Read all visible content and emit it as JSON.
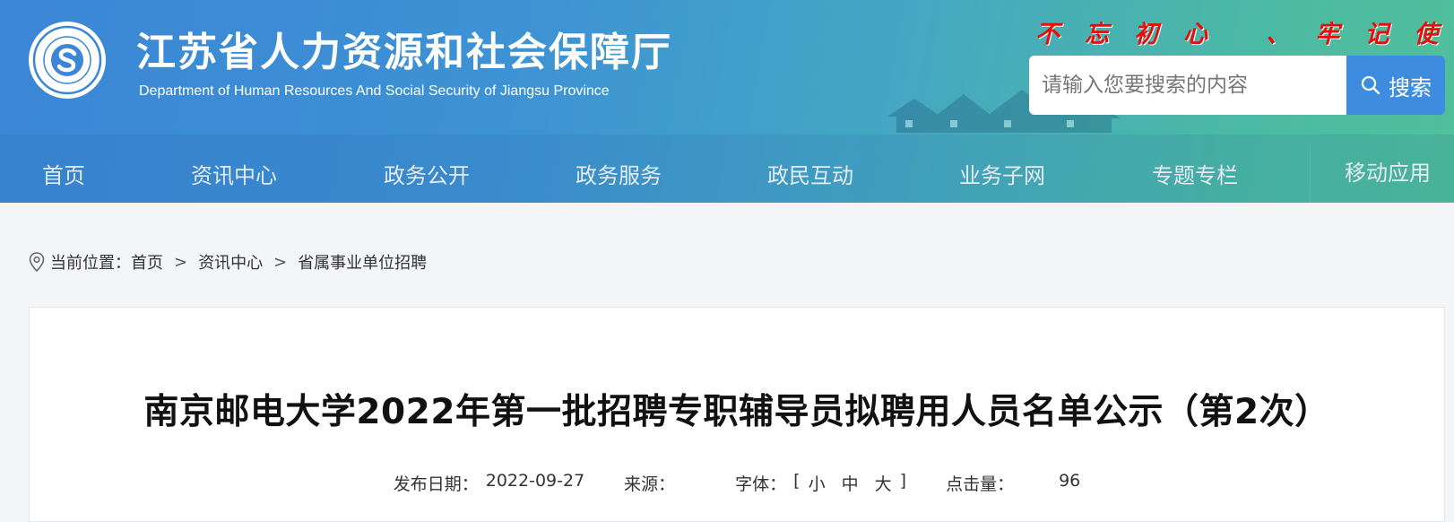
{
  "header": {
    "title": "江苏省人力资源和社会保障厅",
    "subtitle": "Department of Human Resources And Social Security of Jiangsu Province",
    "slogan": "不忘初心 、牢记使命",
    "logo_icon": "social-security-logo-icon",
    "search": {
      "placeholder": "请输入您要搜索的内容",
      "button_label": "搜索",
      "button_color": "#3e8ce0"
    }
  },
  "nav": {
    "items": [
      "首页",
      "资讯中心",
      "政务公开",
      "政务服务",
      "政民互动",
      "业务子网",
      "专题专栏",
      "移动应用"
    ]
  },
  "breadcrumb": {
    "prefix": "当前位置：",
    "items": [
      "首页",
      "资讯中心",
      "省属事业单位招聘"
    ],
    "separator": ">"
  },
  "article": {
    "title": "南京邮电大学2022年第一批招聘专职辅导员拟聘用人员名单公示（第2次）",
    "meta": {
      "date_label": "发布日期：",
      "date": "2022-09-27",
      "source_label": "来源：",
      "source": "",
      "font_label": "字体：",
      "font_open": "[",
      "font_sizes": [
        "小",
        "中",
        "大"
      ],
      "font_close": "]",
      "views_label": "点击量：",
      "views": "96"
    }
  }
}
